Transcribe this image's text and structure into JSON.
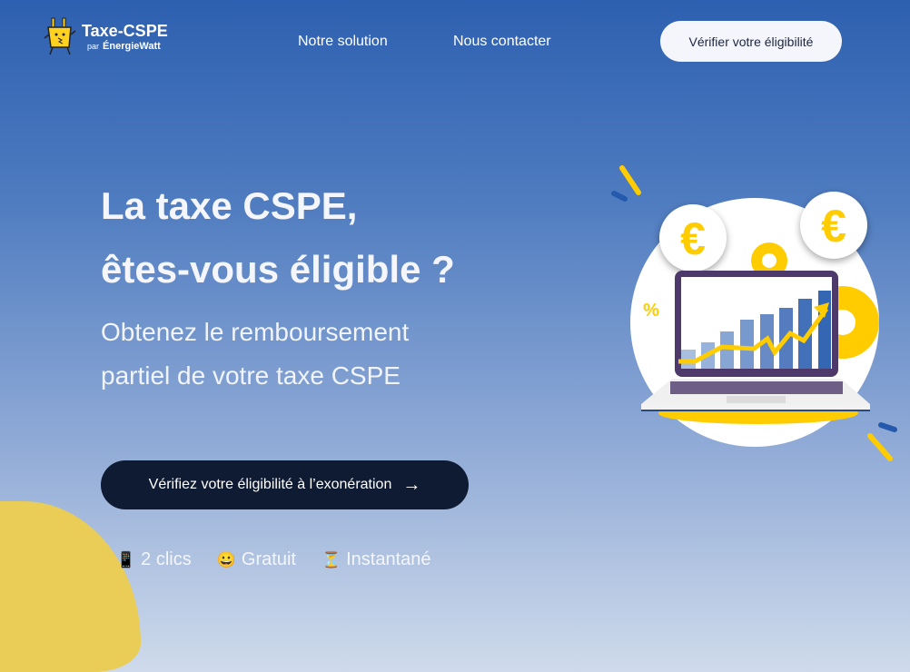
{
  "header": {
    "logo_title": "Taxe-CSPE",
    "logo_by": "par",
    "logo_brand": "ÉnergieWatt",
    "nav": [
      {
        "label": "Notre solution"
      },
      {
        "label": "Nous contacter"
      }
    ],
    "cta_label": "Vérifier votre éligibilité"
  },
  "hero": {
    "title_line1": "La taxe CSPE,",
    "title_line2": "êtes-vous éligible ?",
    "subtitle_line1": "Obtenez le remboursement",
    "subtitle_line2": "partiel de votre taxe CSPE",
    "cta_label": "Vérifiez votre éligibilité à l’exonération",
    "cta_arrow": "→",
    "features": [
      {
        "icon": "📱",
        "label": "2 clics"
      },
      {
        "icon": "😀",
        "label": "Gratuit"
      },
      {
        "icon": "⏳",
        "label": "Instantané"
      }
    ]
  },
  "illustration": {
    "percent": "%",
    "euro": "€"
  },
  "colors": {
    "accent": "#ffcc00",
    "dark": "#0f1a33"
  }
}
